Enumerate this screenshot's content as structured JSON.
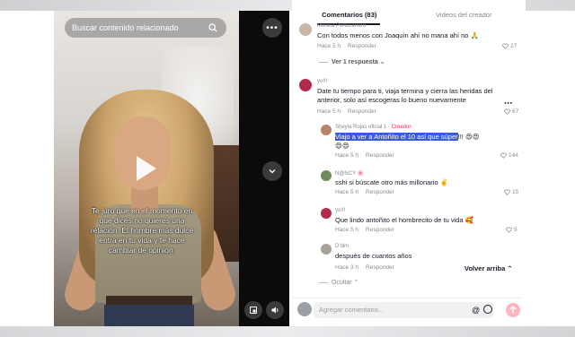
{
  "video": {
    "search_placeholder": "Buscar contenido relacionado",
    "caption": "Te juro que en el momento en que dices no quieres una relación. El hombre más dulce entra en tu vida y te hace cambiar de opinión."
  },
  "tabs": {
    "comments": "Comentarios (83)",
    "creator_videos": "Videos del creador"
  },
  "comments": [
    {
      "name": "Mónica Portocarrero",
      "text": "Con todos menos con Joaquín ahí no mana ahí no 🙏",
      "time": "Hace 5 h",
      "reply": "Responder",
      "likes": "27",
      "view_replies": "Ver 1 respuesta"
    },
    {
      "name": "yo!!!",
      "text": "Date tu tiempo para ti, viaja termina y cierra las heridas del anterior, solo así escogeras lo bueno nuevamente",
      "time": "Hace 5 h",
      "reply": "Responder",
      "likes": "67"
    }
  ],
  "replies": [
    {
      "name": "Sheyla Rojas oficial 1",
      "badge": "· Creador",
      "text_highlight": "Viajo a ver a Antoñito el 10 así que súper",
      "text_suffix": "!!! 😍😍",
      "text_line2": "😍😍",
      "time": "Hace 5 h",
      "reply": "Responder",
      "likes": "144"
    },
    {
      "name": "N@NCY 🌸",
      "text": "sshi si búscate otro más millonario ✌️",
      "time": "Hace 5 h",
      "reply": "Responder",
      "likes": "15"
    },
    {
      "name": "yo!!!",
      "text": "Que lindo antoñito el hombrecito de tu vida 🥰",
      "time": "Hace 5 h",
      "reply": "Responder",
      "likes": "5"
    },
    {
      "name": "D'dim",
      "text": "después de cuantos años",
      "time": "Hace 3 h",
      "reply": "Responder",
      "likes": ""
    }
  ],
  "hide_label": "Ocultar",
  "return_top": "Volver arriba",
  "comment_placeholder": "Agregar comentario...",
  "colors": {
    "brand_red": "#fe2c55",
    "highlight_blue": "#3a5ae0"
  }
}
